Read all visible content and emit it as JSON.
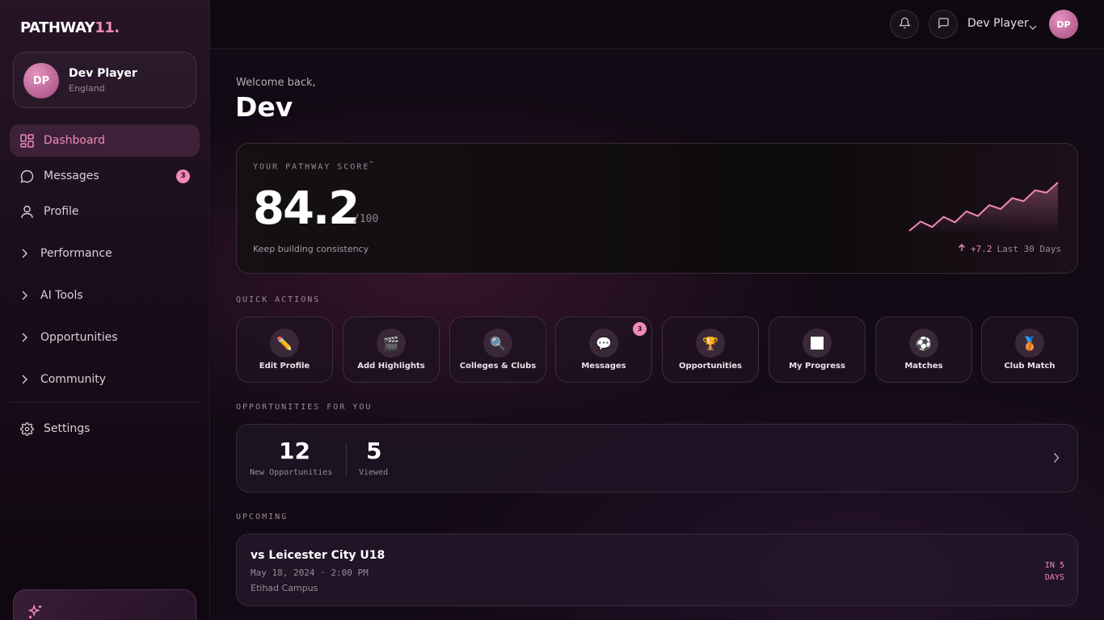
{
  "brand": {
    "name": "PATHWAY",
    "suffix": "11."
  },
  "user": {
    "name": "Dev Player",
    "country": "England",
    "initials": "DP"
  },
  "sidebar": {
    "items": [
      {
        "label": "Dashboard",
        "icon": "dashboard-icon",
        "active": true
      },
      {
        "label": "Messages",
        "icon": "message-icon",
        "badge": "3"
      },
      {
        "label": "Profile",
        "icon": "user-icon"
      },
      {
        "label": "Performance",
        "icon": "chevron-right-icon"
      },
      {
        "label": "AI Tools",
        "icon": "chevron-right-icon"
      },
      {
        "label": "Opportunities",
        "icon": "chevron-right-icon"
      },
      {
        "label": "Community",
        "icon": "chevron-right-icon"
      },
      {
        "label": "Settings",
        "icon": "gear-icon"
      }
    ]
  },
  "header": {
    "user_name": "Dev Player",
    "initials": "DP"
  },
  "welcome": {
    "greeting": "Welcome back,",
    "name": "Dev"
  },
  "score": {
    "label": "YOUR PATHWAY SCORE",
    "trademark": "™",
    "value": "84.2",
    "max": "/100",
    "subtitle": "Keep building consistency",
    "delta": "+7.2",
    "period": "Last 30 Days",
    "trend_points": [
      0,
      12,
      5,
      18,
      11,
      25,
      19,
      33,
      28,
      42,
      38,
      52,
      49,
      62
    ]
  },
  "quick_actions": {
    "title": "QUICK ACTIONS",
    "items": [
      {
        "label": "Edit Profile",
        "glyph": "✏️"
      },
      {
        "label": "Add Highlights",
        "glyph": "🎬"
      },
      {
        "label": "Colleges & Clubs",
        "glyph": "🔍"
      },
      {
        "label": "Messages",
        "glyph": "💬",
        "badge": "3"
      },
      {
        "label": "Opportunities",
        "glyph": "🏆"
      },
      {
        "label": "My Progress",
        "glyph": "⬜"
      },
      {
        "label": "Matches",
        "glyph": "⚽"
      },
      {
        "label": "Club Match",
        "glyph": "🥉"
      }
    ]
  },
  "opportunities": {
    "title": "OPPORTUNITIES FOR YOU",
    "new_count": "12",
    "new_label": "New Opportunities",
    "viewed_count": "5",
    "viewed_label": "Viewed"
  },
  "upcoming": {
    "title": "UPCOMING",
    "match": "vs Leicester City U18",
    "date": "May 18, 2024 · 2:00 PM",
    "venue": "Etihad Campus",
    "when_line1": "IN 5",
    "when_line2": "DAYS"
  },
  "colors": {
    "accent": "#f08ab8",
    "background": "#120a14"
  }
}
